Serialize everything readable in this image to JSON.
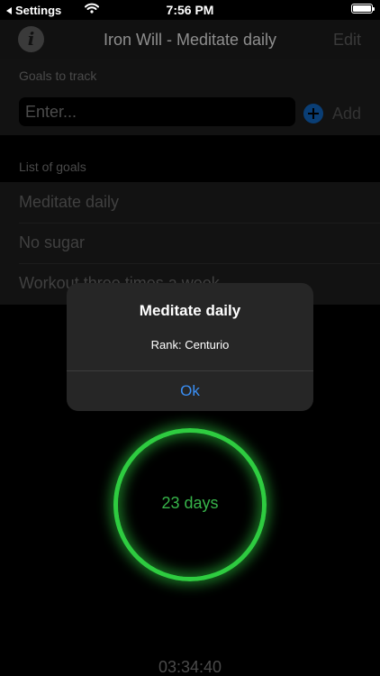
{
  "status_bar": {
    "back_label": "Settings",
    "time": "7:56 PM"
  },
  "nav": {
    "title": "Iron Will - Meditate daily",
    "edit_label": "Edit",
    "info_glyph": "i"
  },
  "goals_section": {
    "header": "Goals to track",
    "input_placeholder": "Enter...",
    "add_label": "Add"
  },
  "goals_list": {
    "header": "List of goals",
    "items": [
      {
        "label": "Meditate daily"
      },
      {
        "label": "No sugar"
      },
      {
        "label": "Workout three times a week"
      }
    ]
  },
  "progress": {
    "days_label": "23 days",
    "timer": "03:34:40"
  },
  "alert": {
    "title": "Meditate daily",
    "message": "Rank: Centurio",
    "ok_label": "Ok"
  },
  "colors": {
    "accent": "#3a8ff5",
    "ring": "#2ecc40",
    "background": "#000000"
  },
  "icons": [
    "back-arrow-icon",
    "wifi-icon",
    "battery-icon",
    "info-icon",
    "add-circle-icon"
  ]
}
